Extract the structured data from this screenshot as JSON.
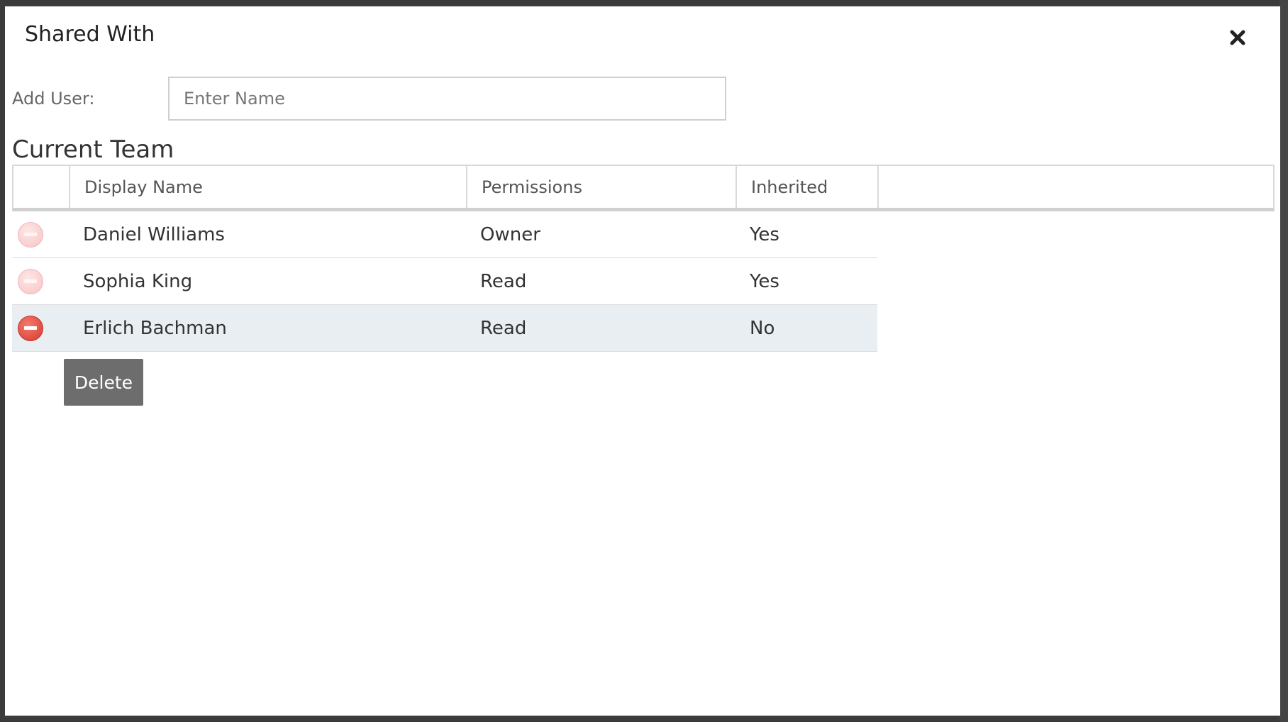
{
  "dialog": {
    "title": "Shared With",
    "close_icon": "close-icon"
  },
  "add_user": {
    "label": "Add User:",
    "placeholder": "Enter Name",
    "value": ""
  },
  "team": {
    "title": "Current Team",
    "columns": [
      "",
      "Display Name",
      "Permissions",
      "Inherited",
      ""
    ],
    "rows": [
      {
        "display_name": "Daniel Williams",
        "permissions": "Owner",
        "inherited": "Yes",
        "selected": false
      },
      {
        "display_name": "Sophia King",
        "permissions": "Read",
        "inherited": "Yes",
        "selected": false
      },
      {
        "display_name": "Erlich Bachman",
        "permissions": "Read",
        "inherited": "No",
        "selected": true
      }
    ]
  },
  "tooltip": {
    "label": "Delete"
  },
  "colors": {
    "remove_active": "#d63a2e",
    "remove_faded": "#f6c4c4",
    "selected_row": "#e9eef2",
    "tooltip_bg": "#6d6d6d"
  }
}
